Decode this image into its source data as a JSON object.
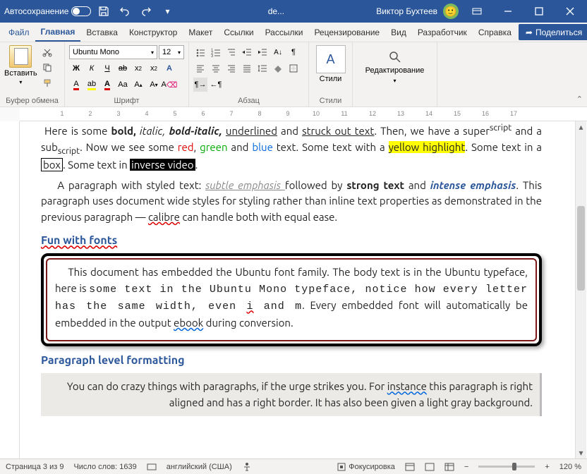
{
  "titlebar": {
    "autosave_label": "Автосохранение",
    "doc_name": "de...",
    "user_name": "Виктор Бухтеев"
  },
  "menu": {
    "file": "Файл",
    "home": "Главная",
    "insert": "Вставка",
    "design": "Конструктор",
    "layout": "Макет",
    "refs": "Ссылки",
    "mail": "Рассылки",
    "review": "Рецензирование",
    "view": "Вид",
    "dev": "Разработчик",
    "help": "Справка",
    "share": "Поделиться"
  },
  "ribbon": {
    "paste": "Вставить",
    "clipboard": "Буфер обмена",
    "font_name": "Ubuntu Mono",
    "font_size": "12",
    "font_group": "Шрифт",
    "para_group": "Абзац",
    "styles_btn": "Стили",
    "styles_group": "Стили",
    "edit_btn": "Редактирование"
  },
  "ruler": {
    "m1": "1",
    "m2": "2",
    "m3": "3",
    "m4": "4",
    "m5": "5",
    "m6": "6",
    "m7": "7",
    "m8": "8",
    "m9": "9",
    "m10": "10",
    "m11": "11",
    "m12": "12",
    "m13": "13",
    "m14": "14",
    "m15": "15",
    "m16": "16",
    "m17": "17"
  },
  "doc": {
    "p1_a": "Here is some ",
    "p1_bold": "bold, ",
    "p1_it": "italic, ",
    "p1_bi": "bold-italic, ",
    "p1_ul": "underlined",
    "p1_and": " and ",
    "p1_st": "struck out  text",
    "p1_end": ". Then, we have a super",
    "p1_sup": "script",
    "p1_mid": " and a sub",
    "p1_sub": "script",
    "p1_c": ". Now we see some ",
    "p1_red": "red",
    "p1_c2": ", ",
    "p1_green": "green",
    "p1_c3": " and ",
    "p1_blue": "blue",
    "p1_c4": " text. Some text with a ",
    "p1_yh": "yellow highlight",
    "p1_c5": ". Some text in a ",
    "p1_box": "box",
    "p1_c6": ". Some text in ",
    "p1_inv": "inverse video",
    "p1_c7": ".",
    "p2_a": "A paragraph with styled text: ",
    "p2_sub": "subtle emphasis ",
    "p2_b": " followed by ",
    "p2_strong": "strong text",
    "p2_c": " and ",
    "p2_int": "intense emphasis",
    "p2_d": ". This paragraph uses document wide styles for styling rather than inline text properties as demonstrated in the previous paragraph — ",
    "p2_cal": "calibre",
    "p2_e": " can handle both with equal ease.",
    "h_fun": "Fun with fonts",
    "fun_a": "This document has embedded the Ubuntu font family. The body text is in the Ubuntu typeface, here is ",
    "fun_mono": "some text in the Ubuntu Mono typeface, notice how every letter has the same width, even ",
    "fun_i": "i",
    "fun_mono2": " and ",
    "fun_m": "m",
    "fun_b": ". Every embedded font will automatically be embedded in the output ",
    "fun_eb": "ebook",
    "fun_c": " during conversion.",
    "h_para": "Paragraph level formatting",
    "pr_a": "You can do crazy things with paragraphs, if the urge strikes you. For ",
    "pr_inst": "instance",
    "pr_b": " this paragraph is right aligned and has a right border. It has also been given a light gray background."
  },
  "status": {
    "page": "Страница 3 из 9",
    "words": "Число слов: 1639",
    "lang": "английский (США)",
    "focus": "Фокусировка",
    "zoom": "120 %"
  }
}
